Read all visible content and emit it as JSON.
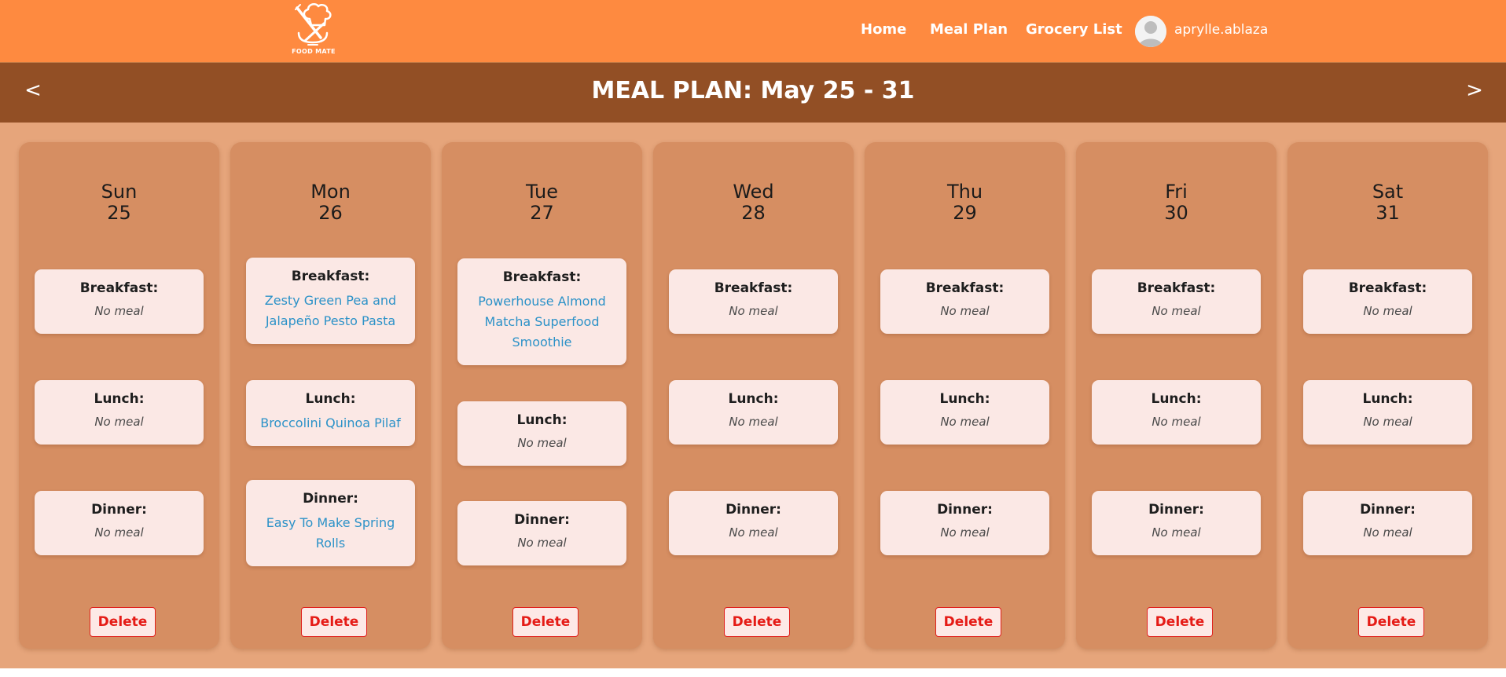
{
  "brand": {
    "logo_text": "FOOD MATE"
  },
  "nav": {
    "home": "Home",
    "meal_plan": "Meal Plan",
    "grocery_list": "Grocery List",
    "username": "aprylle.ablaza"
  },
  "header": {
    "title": "MEAL PLAN: May 25 - 31",
    "prev": "<",
    "next": ">"
  },
  "labels": {
    "breakfast": "Breakfast:",
    "lunch": "Lunch:",
    "dinner": "Dinner:",
    "no_meal": "No meal",
    "delete": "Delete"
  },
  "days": [
    {
      "name": "Sun",
      "date": "25",
      "breakfast": "No meal",
      "lunch": "No meal",
      "dinner": "No meal"
    },
    {
      "name": "Mon",
      "date": "26",
      "breakfast": "Zesty Green Pea and Jalapeño Pesto Pasta",
      "lunch": "Broccolini Quinoa Pilaf",
      "dinner": "Easy To Make Spring Rolls"
    },
    {
      "name": "Tue",
      "date": "27",
      "breakfast": "Powerhouse Almond Matcha Superfood Smoothie",
      "lunch": "No meal",
      "dinner": "No meal"
    },
    {
      "name": "Wed",
      "date": "28",
      "breakfast": "No meal",
      "lunch": "No meal",
      "dinner": "No meal"
    },
    {
      "name": "Thu",
      "date": "29",
      "breakfast": "No meal",
      "lunch": "No meal",
      "dinner": "No meal"
    },
    {
      "name": "Fri",
      "date": "30",
      "breakfast": "No meal",
      "lunch": "No meal",
      "dinner": "No meal"
    },
    {
      "name": "Sat",
      "date": "31",
      "breakfast": "No meal",
      "lunch": "No meal",
      "dinner": "No meal"
    }
  ],
  "colors": {
    "topbar": "#fe8a40",
    "header_band": "#924f25",
    "planner_bg": "#e6a57b",
    "day_column": "#d68e62",
    "meal_card": "#fbe8e5",
    "meal_link": "#2c92c8",
    "delete": "#e51b16"
  }
}
